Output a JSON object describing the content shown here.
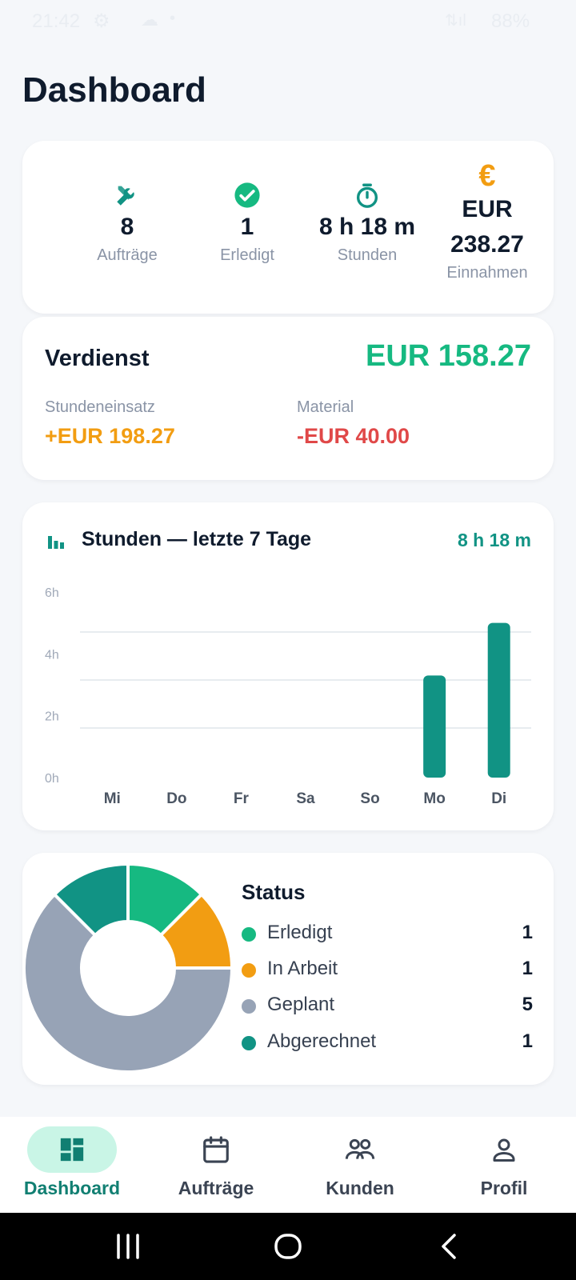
{
  "statusbar": {
    "time": "21:42",
    "battery": "88%"
  },
  "page_title": "Dashboard",
  "stats": [
    {
      "icon": "tools-icon",
      "value": "8",
      "label": "Aufträge"
    },
    {
      "icon": "check-circle-icon",
      "value": "1",
      "label": "Erledigt"
    },
    {
      "icon": "stopwatch-icon",
      "value": "8 h 18 m",
      "label": "Stunden"
    },
    {
      "icon": "euro-icon",
      "value_line1": "EUR",
      "value_line2": "238.27",
      "label": "Einnahmen"
    }
  ],
  "earnings": {
    "title": "Verdienst",
    "total": "EUR 158.27",
    "hours_label": "Stundeneinsatz",
    "hours_value": "+EUR 198.27",
    "material_label": "Material",
    "material_value": "-EUR 40.00"
  },
  "chart_card": {
    "title": "Stunden — letzte 7 Tage",
    "total": "8 h 18 m"
  },
  "chart_data": {
    "type": "bar",
    "categories": [
      "Mi",
      "Do",
      "Fr",
      "Sa",
      "So",
      "Mo",
      "Di"
    ],
    "values": [
      0,
      0,
      0,
      0,
      0,
      3.3,
      5.0
    ],
    "yticks": [
      "6h",
      "4h",
      "2h",
      "0h"
    ],
    "ylim": [
      0,
      6
    ],
    "color": "#119384"
  },
  "status": {
    "title": "Status",
    "items": [
      {
        "name": "Erledigt",
        "count": "1",
        "value": 1,
        "color": "#16b981"
      },
      {
        "name": "In Arbeit",
        "count": "1",
        "value": 1,
        "color": "#f29d12"
      },
      {
        "name": "Geplant",
        "count": "5",
        "value": 5,
        "color": "#97a3b6"
      },
      {
        "name": "Abgerechnet",
        "count": "1",
        "value": 1,
        "color": "#119384"
      }
    ]
  },
  "bottom_nav": [
    {
      "label": "Dashboard",
      "icon": "dashboard-icon",
      "active": true
    },
    {
      "label": "Aufträge",
      "icon": "calendar-icon",
      "active": false
    },
    {
      "label": "Kunden",
      "icon": "people-icon",
      "active": false
    },
    {
      "label": "Profil",
      "icon": "person-icon",
      "active": false
    }
  ],
  "colors": {
    "accent": "#119384",
    "green": "#16b981",
    "orange": "#f29d12",
    "red": "#e04848",
    "gray": "#97a3b6"
  }
}
